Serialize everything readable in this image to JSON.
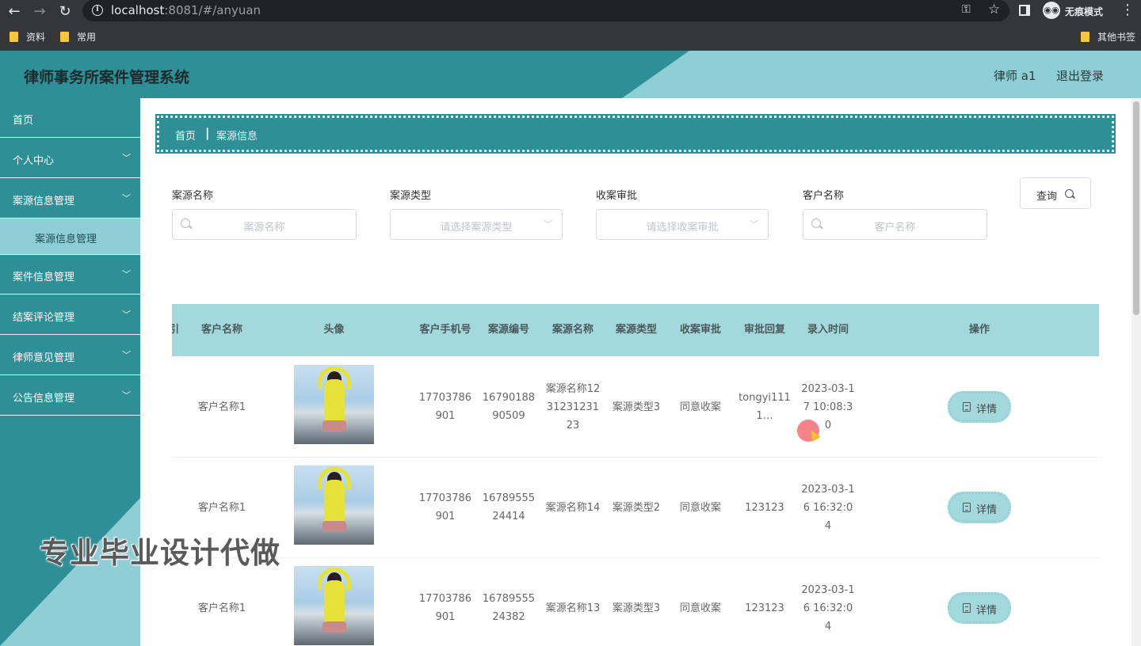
{
  "browser": {
    "url_host": "localhost",
    "url_rest": ":8081/#/anyuan",
    "incognito_label": "无痕模式",
    "bookmarks": [
      "资料",
      "常用"
    ],
    "other_bookmarks": "其他书签"
  },
  "header": {
    "title": "律师事务所案件管理系统",
    "user": "律师 a1",
    "logout": "退出登录"
  },
  "sidebar": {
    "items": [
      {
        "label": "首页"
      },
      {
        "label": "个人中心"
      },
      {
        "label": "案源信息管理"
      },
      {
        "label": "案件信息管理"
      },
      {
        "label": "结案评论管理"
      },
      {
        "label": "律师意见管理"
      },
      {
        "label": "公告信息管理"
      }
    ],
    "active_sub": "案源信息管理"
  },
  "breadcrumb": {
    "home": "首页",
    "separator": "|",
    "current": "案源信息"
  },
  "search": {
    "fields": [
      {
        "label": "案源名称",
        "placeholder": "案源名称"
      },
      {
        "label": "案源类型",
        "placeholder": "请选择案源类型"
      },
      {
        "label": "收案审批",
        "placeholder": "请选择收案审批"
      },
      {
        "label": "客户名称",
        "placeholder": "客户名称"
      }
    ],
    "query_label": "查询"
  },
  "table": {
    "headers": [
      "引",
      "客户名称",
      "头像",
      "客户手机号",
      "案源编号",
      "案源名称",
      "案源类型",
      "收案审批",
      "审批回复",
      "录入时间",
      "操作"
    ],
    "detail_label": "详情",
    "rows": [
      {
        "customer": "客户名称1",
        "phone": "17703786901",
        "code": "1679018890509",
        "name": "案源名称123123123123",
        "type": "案源类型3",
        "approval": "同意收案",
        "reply": "tongyi1111…",
        "time": "2023-03-17 10:08:30"
      },
      {
        "customer": "客户名称1",
        "phone": "17703786901",
        "code": "1678955524414",
        "name": "案源名称14",
        "type": "案源类型2",
        "approval": "同意收案",
        "reply": "123123",
        "time": "2023-03-16 16:32:04"
      },
      {
        "customer": "客户名称1",
        "phone": "17703786901",
        "code": "1678955524382",
        "name": "案源名称13",
        "type": "案源类型3",
        "approval": "同意收案",
        "reply": "123123",
        "time": "2023-03-16 16:32:04"
      }
    ]
  },
  "watermark": "专业毕业设计代做"
}
